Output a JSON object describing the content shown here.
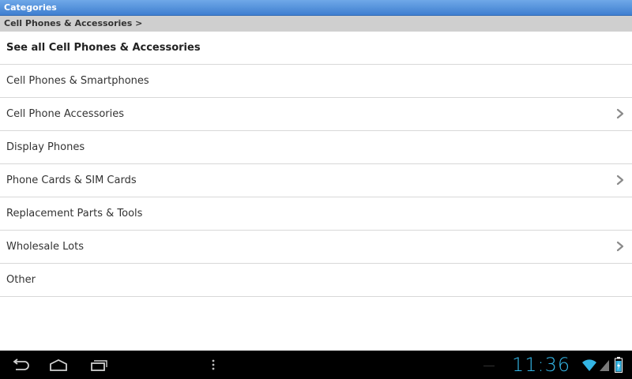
{
  "header": {
    "title": "Categories",
    "breadcrumb": "Cell Phones & Accessories >"
  },
  "categories": [
    {
      "label": "See all Cell Phones & Accessories",
      "has_children": false
    },
    {
      "label": "Cell Phones & Smartphones",
      "has_children": false
    },
    {
      "label": "Cell Phone Accessories",
      "has_children": true
    },
    {
      "label": "Display Phones",
      "has_children": false
    },
    {
      "label": "Phone Cards & SIM Cards",
      "has_children": true
    },
    {
      "label": "Replacement Parts & Tools",
      "has_children": false
    },
    {
      "label": "Wholesale Lots",
      "has_children": true
    },
    {
      "label": "Other",
      "has_children": false
    }
  ],
  "system_bar": {
    "time": "11:36",
    "icons": [
      "back-icon",
      "home-icon",
      "recent-apps-icon",
      "menu-icon",
      "wifi-icon",
      "cell-signal-icon",
      "battery-icon"
    ],
    "accent_color": "#33b5e5"
  }
}
